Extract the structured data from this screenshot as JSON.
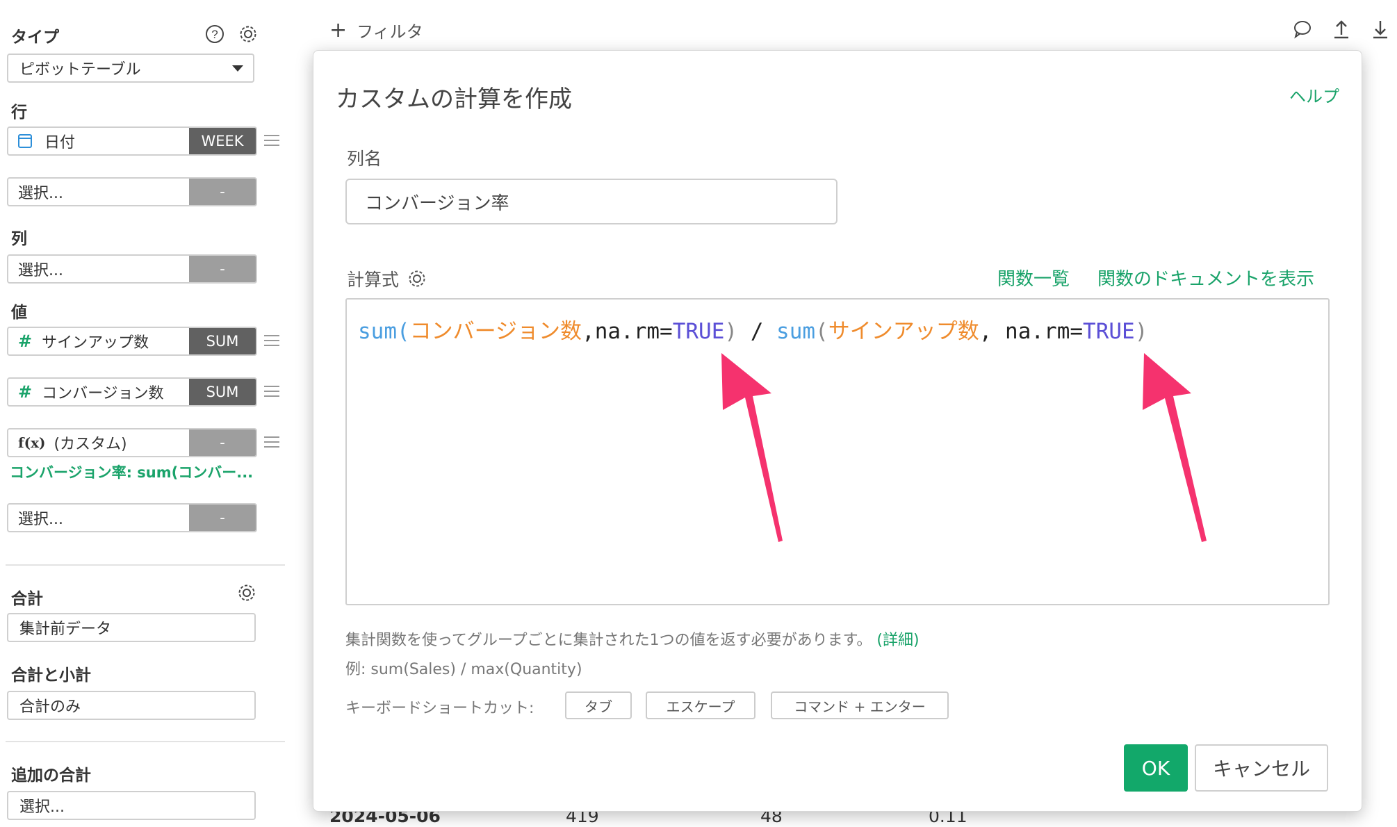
{
  "sidebar": {
    "type_label": "タイプ",
    "type_value": "ピボットテーブル",
    "rows_label": "行",
    "row_field": {
      "name": "日付",
      "agg": "WEEK"
    },
    "row_select": {
      "name": "選択...",
      "agg": "-"
    },
    "columns_label": "列",
    "column_select": {
      "name": "選択...",
      "agg": "-"
    },
    "values_label": "値",
    "value_fields": [
      {
        "icon": "#",
        "name": "サインアップ数",
        "agg": "SUM"
      },
      {
        "icon": "#",
        "name": "コンバージョン数",
        "agg": "SUM"
      },
      {
        "icon": "f(x)",
        "name": "(カスタム)",
        "agg": "-"
      }
    ],
    "custom_note": "コンバージョン率: sum(コンバー...",
    "value_select": {
      "name": "選択...",
      "agg": "-"
    },
    "total_label": "合計",
    "total_value": "集計前データ",
    "subtotal_label": "合計と小計",
    "subtotal_value": "合計のみ",
    "extra_total_label": "追加の合計",
    "extra_total_value": "選択..."
  },
  "topbar": {
    "filter_label": "フィルタ"
  },
  "background_row": {
    "date": "2024-05-06",
    "v1": "419",
    "v2": "48",
    "v3": "0.11"
  },
  "modal": {
    "title": "カスタムの計算を作成",
    "help": "ヘルプ",
    "column_name_label": "列名",
    "column_name_value": "コンバージョン率",
    "formula_label": "計算式",
    "functions_link": "関数一覧",
    "docs_link": "関数のドキュメントを表示",
    "formula_tokens": [
      {
        "t": "sum",
        "c": "fn"
      },
      {
        "t": "(",
        "c": "fn"
      },
      {
        "t": "コンバージョン数",
        "c": "col"
      },
      {
        "t": ",na.rm=",
        "c": "txt"
      },
      {
        "t": "TRUE",
        "c": "kw"
      },
      {
        "t": ")",
        "c": "par"
      },
      {
        "t": " / ",
        "c": "txt"
      },
      {
        "t": "sum",
        "c": "fn"
      },
      {
        "t": "(",
        "c": "par"
      },
      {
        "t": "サインアップ数",
        "c": "col"
      },
      {
        "t": ", na.rm=",
        "c": "txt"
      },
      {
        "t": "TRUE",
        "c": "kw"
      },
      {
        "t": ")",
        "c": "par"
      }
    ],
    "hint_text": "集計関数を使ってグループごとに集計された1つの値を返す必要があります。",
    "hint_link": "(詳細)",
    "example": "例: sum(Sales) / max(Quantity)",
    "shortcut_label": "キーボードショートカット:",
    "shortcuts": [
      "タブ",
      "エスケープ",
      "コマンド + エンター"
    ],
    "ok": "OK",
    "cancel": "キャンセル"
  },
  "colors": {
    "accent_green": "#1aa36a",
    "arrow_pink": "#f5326e"
  }
}
